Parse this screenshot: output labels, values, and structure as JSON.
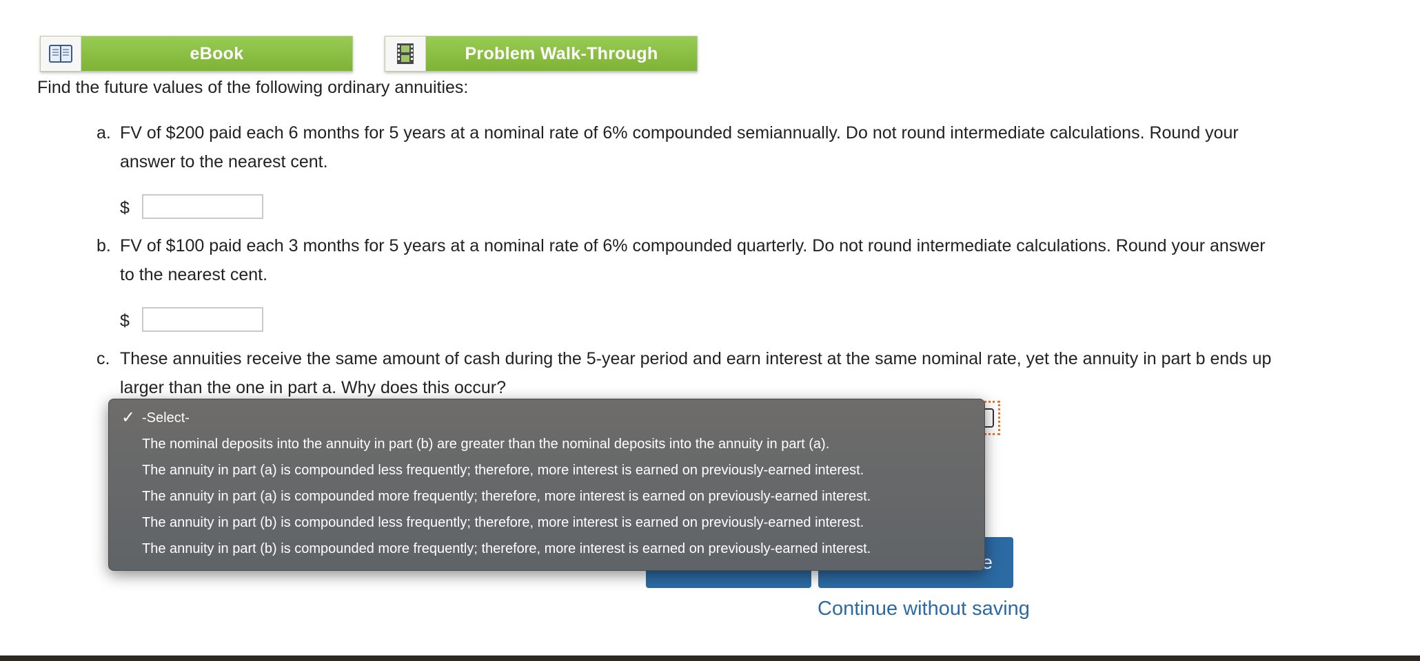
{
  "toolbar": {
    "ebook_label": "eBook",
    "walkthrough_label": "Problem Walk-Through"
  },
  "intro": "Find the future values of the following ordinary annuities:",
  "questions": [
    {
      "letter": "a.",
      "line1": "FV of $200 paid each 6 months for 5 years at a nominal rate of 6% compounded semiannually. Do not round intermediate calculations. Round your",
      "line2": "answer to the nearest cent.",
      "currency": "$",
      "value": ""
    },
    {
      "letter": "b.",
      "line1": "FV of $100 paid each 3 months for 5 years at a nominal rate of 6% compounded quarterly. Do not round intermediate calculations. Round your answer",
      "line2": "to the nearest cent.",
      "currency": "$",
      "value": ""
    },
    {
      "letter": "c.",
      "line1": "These annuities receive the same amount of cash during the 5-year period and earn interest at the same nominal rate, yet the annuity in part b ends up",
      "line2": "larger than the one in part a. Why does this occur?"
    }
  ],
  "dropdown": {
    "selected": "-Select-",
    "options": [
      "-Select-",
      "The nominal deposits into the annuity in part (b) are greater than the nominal deposits into the annuity in part (a).",
      "The annuity in part (a) is compounded less frequently; therefore, more interest is earned on previously-earned interest.",
      "The annuity in part (a) is compounded more frequently; therefore, more interest is earned on previously-earned interest.",
      "The annuity in part (b) is compounded less frequently; therefore, more interest is earned on previously-earned interest.",
      "The annuity in part (b) is compounded more frequently; therefore, more interest is earned on previously-earned interest."
    ]
  },
  "footer": {
    "visible_right_button_fragment": "e",
    "continue_label": "Continue without saving"
  },
  "colors": {
    "green_button": "#8cc043",
    "blue_button": "#2c6aa3",
    "dropdown_bg": "#676767",
    "focus_outline": "#e8762b"
  },
  "icons": {
    "ebook": "book-icon",
    "walkthrough": "film-icon",
    "selected_option": "checkmark-icon"
  }
}
